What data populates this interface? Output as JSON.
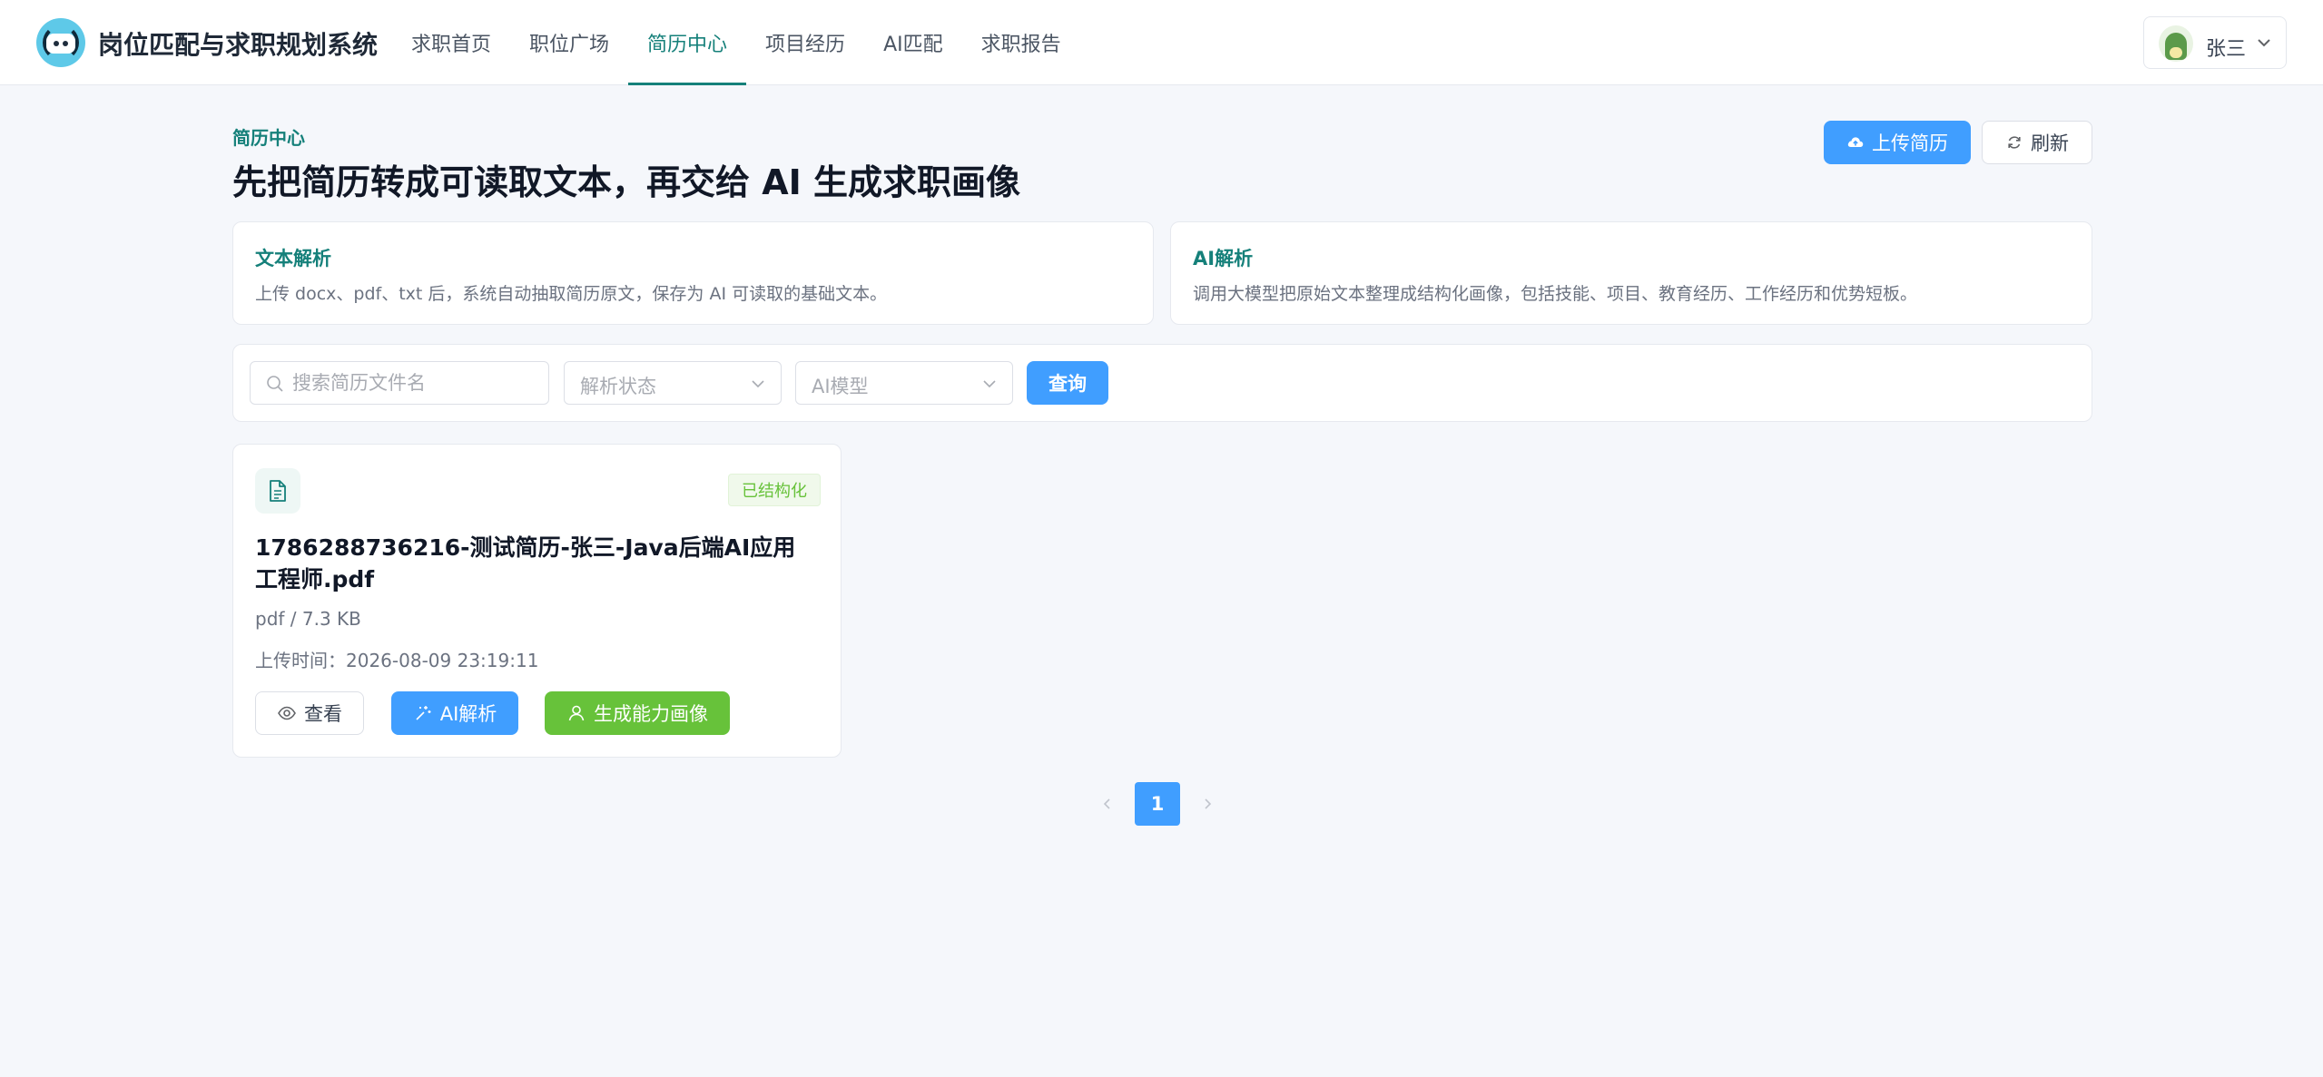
{
  "app": {
    "title": "岗位匹配与求职规划系统"
  },
  "nav": {
    "items": [
      {
        "label": "求职首页"
      },
      {
        "label": "职位广场"
      },
      {
        "label": "简历中心"
      },
      {
        "label": "项目经历"
      },
      {
        "label": "AI匹配"
      },
      {
        "label": "求职报告"
      }
    ],
    "active": "简历中心"
  },
  "user": {
    "name": "张三"
  },
  "header": {
    "eyebrow": "简历中心",
    "title": "先把简历转成可读取文本，再交给 AI 生成求职画像",
    "upload_label": "上传简历",
    "refresh_label": "刷新"
  },
  "info_cards": [
    {
      "title": "文本解析",
      "desc": "上传 docx、pdf、txt 后，系统自动抽取简历原文，保存为 AI 可读取的基础文本。"
    },
    {
      "title": "AI解析",
      "desc": "调用大模型把原始文本整理成结构化画像，包括技能、项目、教育经历、工作经历和优势短板。"
    }
  ],
  "filters": {
    "search_placeholder": "搜索简历文件名",
    "status_placeholder": "解析状态",
    "model_placeholder": "AI模型",
    "query_label": "查询"
  },
  "resumes": [
    {
      "status": "已结构化",
      "file_name": "1786288736216-测试简历-张三-Java后端AI应用工程师.pdf",
      "meta": "pdf / 7.3 KB",
      "upload_time_label": "上传时间：",
      "upload_time": "2026-08-09 23:19:11",
      "view_label": "查看",
      "ai_label": "AI解析",
      "generate_label": "生成能力画像"
    }
  ],
  "pagination": {
    "current": "1"
  },
  "colors": {
    "accent": "#15807a",
    "primary": "#409eff",
    "success": "#67c23a",
    "background": "#f5f7fb"
  }
}
